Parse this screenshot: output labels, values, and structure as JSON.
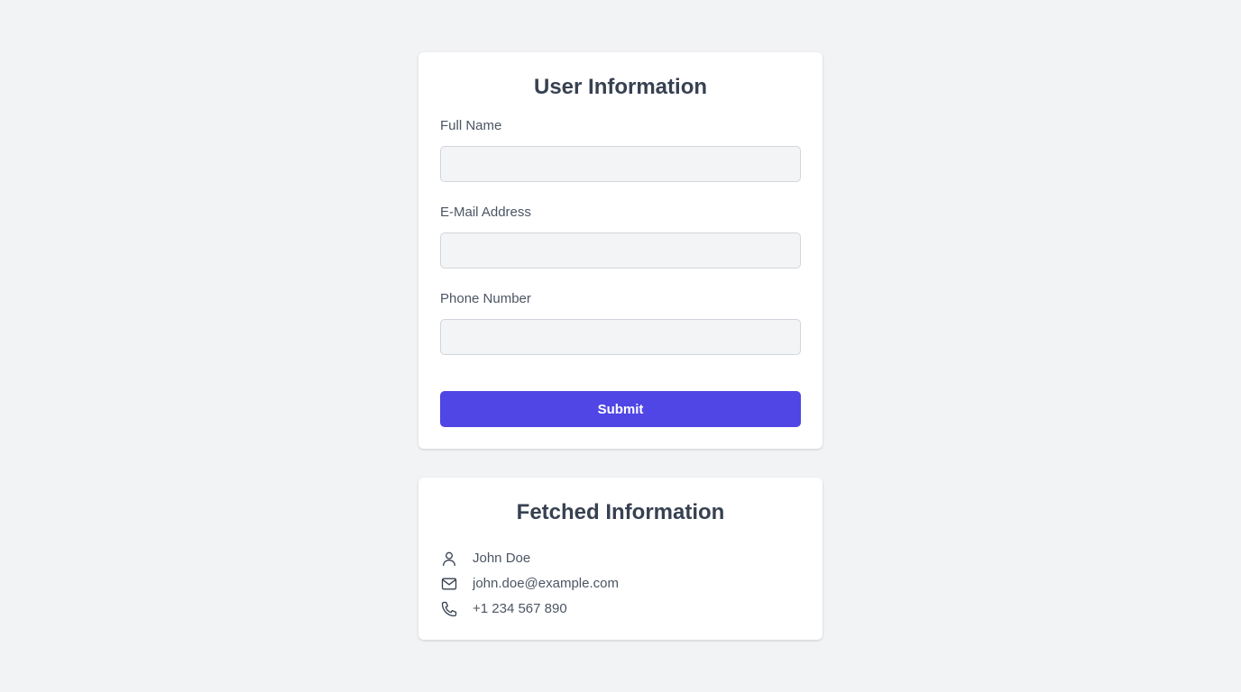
{
  "form": {
    "title": "User Information",
    "fields": [
      {
        "label": "Full Name",
        "value": "",
        "placeholder": ""
      },
      {
        "label": "E-Mail Address",
        "value": "",
        "placeholder": ""
      },
      {
        "label": "Phone Number",
        "value": "",
        "placeholder": ""
      }
    ],
    "submit_label": "Submit"
  },
  "fetched": {
    "title": "Fetched Information",
    "rows": [
      {
        "icon": "user-icon",
        "text": "John Doe"
      },
      {
        "icon": "mail-icon",
        "text": "john.doe@example.com"
      },
      {
        "icon": "phone-icon",
        "text": "+1 234 567 890"
      }
    ]
  },
  "colors": {
    "background": "#f2f3f5",
    "accent": "#4f46e5",
    "text": "#374151"
  }
}
